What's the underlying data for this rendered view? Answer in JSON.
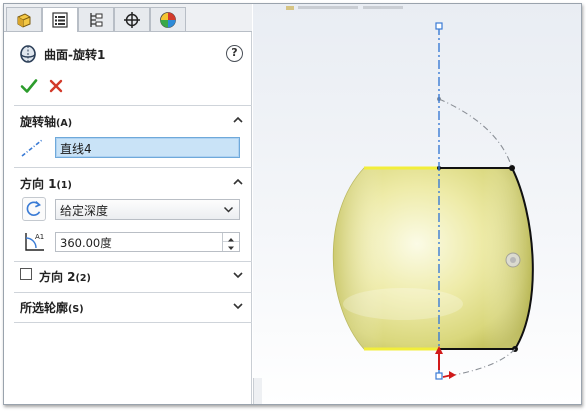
{
  "panel": {
    "tabs": [
      {
        "name": "feature-manager"
      },
      {
        "name": "property-manager",
        "active": true
      },
      {
        "name": "configuration-manager"
      },
      {
        "name": "dimxpert-manager"
      },
      {
        "name": "display-manager"
      }
    ],
    "title": "曲面-旋转1",
    "help_label": "?",
    "axis_section": {
      "title": "旋转轴",
      "shortcut": "(A)",
      "value": "直线4"
    },
    "direction1_section": {
      "title": "方向 1",
      "shortcut": "(1)",
      "end_condition": "给定深度",
      "angle": "360.00度"
    },
    "direction2_section": {
      "title": "方向 2",
      "shortcut": "(2)",
      "checked": false
    },
    "contours_section": {
      "title": "所选轮廓",
      "shortcut": "(S)"
    }
  },
  "colors": {
    "ok_green": "#2c9c2c",
    "cancel_red": "#d23a2a",
    "axis_blue": "#3a7bd5",
    "surface_yellow": "#f0eda0",
    "field_highlight": "#c9e3f7"
  }
}
